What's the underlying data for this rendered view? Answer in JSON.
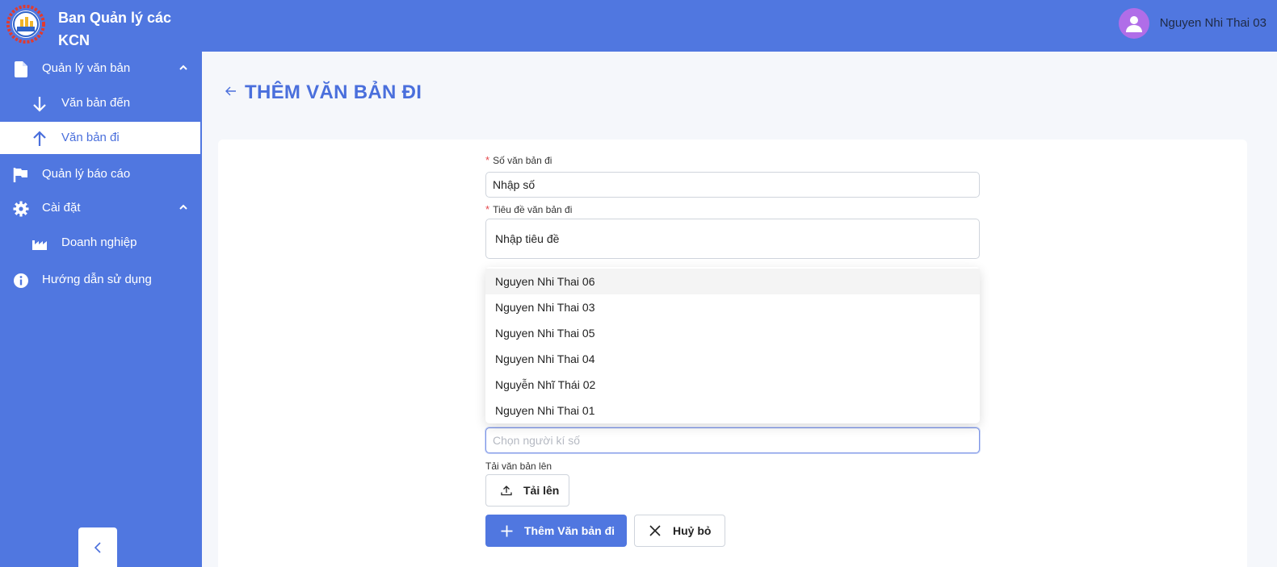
{
  "sidebar": {
    "brand_title": "Ban Quản lý các KCN",
    "items": [
      {
        "label": "Quản lý văn bản",
        "icon": "document-icon"
      },
      {
        "label": "Văn bản đến",
        "icon": "arrow-down-icon"
      },
      {
        "label": "Văn bản đi",
        "icon": "arrow-up-icon"
      },
      {
        "label": "Quản lý báo cáo",
        "icon": "flag-icon"
      },
      {
        "label": "Cài đặt",
        "icon": "gear-icon"
      },
      {
        "label": "Doanh nghiệp",
        "icon": "factory-icon"
      },
      {
        "label": "Hướng dẫn sử dụng",
        "icon": "info-icon"
      }
    ]
  },
  "header": {
    "user_name": "Nguyen Nhi Thai 03"
  },
  "page": {
    "title": "THÊM VĂN BẢN ĐI"
  },
  "form": {
    "number_label": "Số văn bản đi",
    "number_value": "Nhập số",
    "title_label": "Tiêu đề văn bản đi",
    "title_value": "Nhập tiêu đề",
    "signer_placeholder": "Chọn người kí số",
    "upload_label": "Tải văn bản lên",
    "upload_button": "Tải lên",
    "submit_button": "Thêm Văn bản đi",
    "cancel_button": "Huỷ bỏ"
  },
  "dropdown": {
    "options": [
      "Nguyen Nhi Thai 06",
      "Nguyen Nhi Thai 03",
      "Nguyen Nhi Thai 05",
      "Nguyen Nhi Thai 04",
      "Nguyễn Nhĩ Thái 02",
      "Nguyen Nhi Thai 01"
    ]
  },
  "colors": {
    "primary": "#5077e0",
    "title": "#4a6fdc",
    "avatar": "#b06de8",
    "required": "#e5484d"
  }
}
